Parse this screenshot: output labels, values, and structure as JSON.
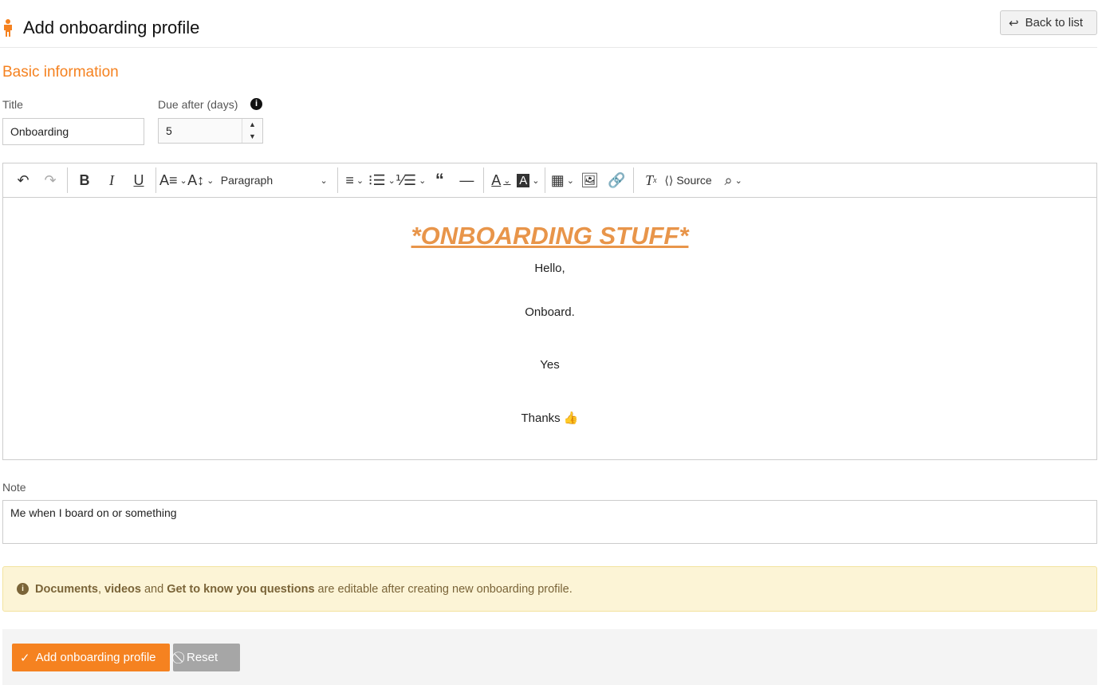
{
  "header": {
    "title": "Add onboarding profile",
    "back_label": "Back to list"
  },
  "form": {
    "section": "Basic information",
    "title_label": "Title",
    "title_value": "Onboarding",
    "due_label": "Due after (days)",
    "due_value": "5",
    "note_label": "Note",
    "note_value": "Me when I board on or something"
  },
  "toolbar": {
    "paragraph": "Paragraph",
    "source": "Source"
  },
  "editor": {
    "heading": "*ONBOARDING STUFF*",
    "lines": [
      "Hello,",
      "Onboard.",
      "Yes",
      "Thanks 👍"
    ]
  },
  "alert": {
    "b1": "Documents",
    ", ": ", ",
    "b2": "videos",
    "and": " and ",
    "b3": "Get to know you questions",
    "rest": " are editable after creating new onboarding profile."
  },
  "actions": {
    "submit": "Add onboarding profile",
    "reset": "Reset"
  },
  "colors": {
    "accent": "#f58220",
    "heading": "#e8954a"
  }
}
